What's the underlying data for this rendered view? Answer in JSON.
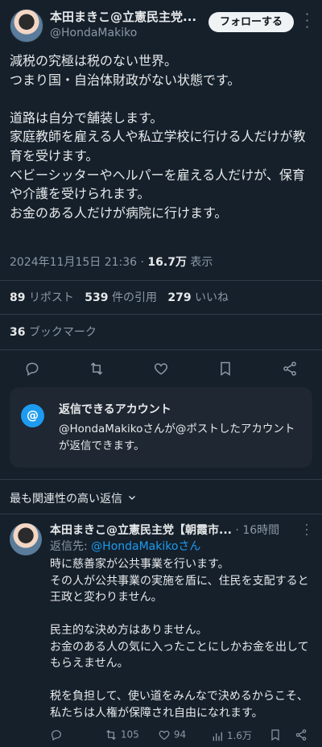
{
  "author": {
    "name": "本田まきこ@立憲民主党...",
    "handle": "@HondaMakiko"
  },
  "follow_label": "フォローする",
  "tweet": {
    "text": "減税の究極は税のない世界。\nつまり国・自治体財政がない状態です。\n\n道路は自分で舗装します。\n家庭教師を雇える人や私立学校に行ける人だけが教育を受けます。\nベビーシッターやヘルパーを雇える人だけが、保育や介護を受けられます。\nお金のある人だけが病院に行けます。",
    "timestamp": "2024年11月15日 21:36",
    "separator": "·",
    "views_count": "16.7万",
    "views_label": "表示"
  },
  "stats": {
    "reposts_count": "89",
    "reposts_label": "リポスト",
    "quotes_count": "539",
    "quotes_label": "件の引用",
    "likes_count": "279",
    "likes_label": "いいね",
    "bookmarks_count": "36",
    "bookmarks_label": "ブックマーク"
  },
  "reply_card": {
    "icon_text": "@",
    "title": "返信できるアカウント",
    "body": "@HondaMakikoさんが@ポストしたアカウントが返信できます。"
  },
  "sort": {
    "label": "最も関連性の高い返信"
  },
  "reply": {
    "name": "本田まきこ@立憲民主党【朝霞市...",
    "dot": "·",
    "time": "16時間",
    "reply_to_prefix": "返信先: ",
    "reply_to_handle": "@HondaMakikoさん",
    "text": "時に慈善家が公共事業を行います。\nその人が公共事業の実施を盾に、住民を支配すると王政と変わりません。\n\n民主的な決め方はありません。\nお金のある人の気に入ったことにしかお金を出してもらえません。\n\n税を負担して、使い道をみんなで決めるからこそ、私たちは人権が保障され自由になれます。",
    "retweets": "105",
    "likes": "94",
    "views": "1.6万"
  },
  "colors": {
    "background": "#15202b",
    "text": "#e7e9ea",
    "muted": "#8b98a5",
    "accent": "#1d9bf0",
    "card": "#1e2732"
  }
}
